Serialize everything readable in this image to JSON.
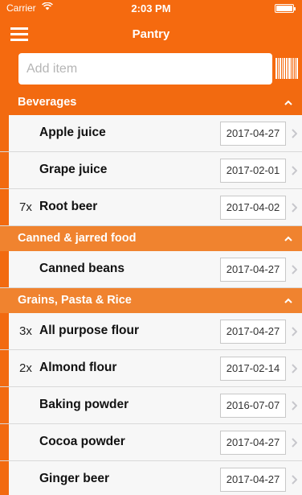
{
  "status_bar": {
    "carrier": "Carrier",
    "time": "2:03 PM"
  },
  "navbar": {
    "title": "Pantry"
  },
  "add_item": {
    "placeholder": "Add item"
  },
  "colors": {
    "header": "#f56a0f",
    "section": "#f0832f",
    "stripe": "#f26a10"
  },
  "sections": [
    {
      "name": "Beverages",
      "items": [
        {
          "qty": "",
          "name": "Apple juice",
          "date": "2017-04-27"
        },
        {
          "qty": "",
          "name": "Grape juice",
          "date": "2017-02-01"
        },
        {
          "qty": "7x",
          "name": "Root beer",
          "date": "2017-04-02"
        }
      ]
    },
    {
      "name": "Canned & jarred food",
      "items": [
        {
          "qty": "",
          "name": "Canned beans",
          "date": "2017-04-27"
        }
      ]
    },
    {
      "name": "Grains, Pasta & Rice",
      "items": [
        {
          "qty": "3x",
          "name": "All purpose flour",
          "date": "2017-04-27"
        },
        {
          "qty": "2x",
          "name": "Almond flour",
          "date": "2017-02-14"
        },
        {
          "qty": "",
          "name": "Baking powder",
          "date": "2016-07-07"
        },
        {
          "qty": "",
          "name": "Cocoa powder",
          "date": "2017-04-27"
        },
        {
          "qty": "",
          "name": "Ginger beer",
          "date": "2017-04-27"
        }
      ]
    }
  ]
}
